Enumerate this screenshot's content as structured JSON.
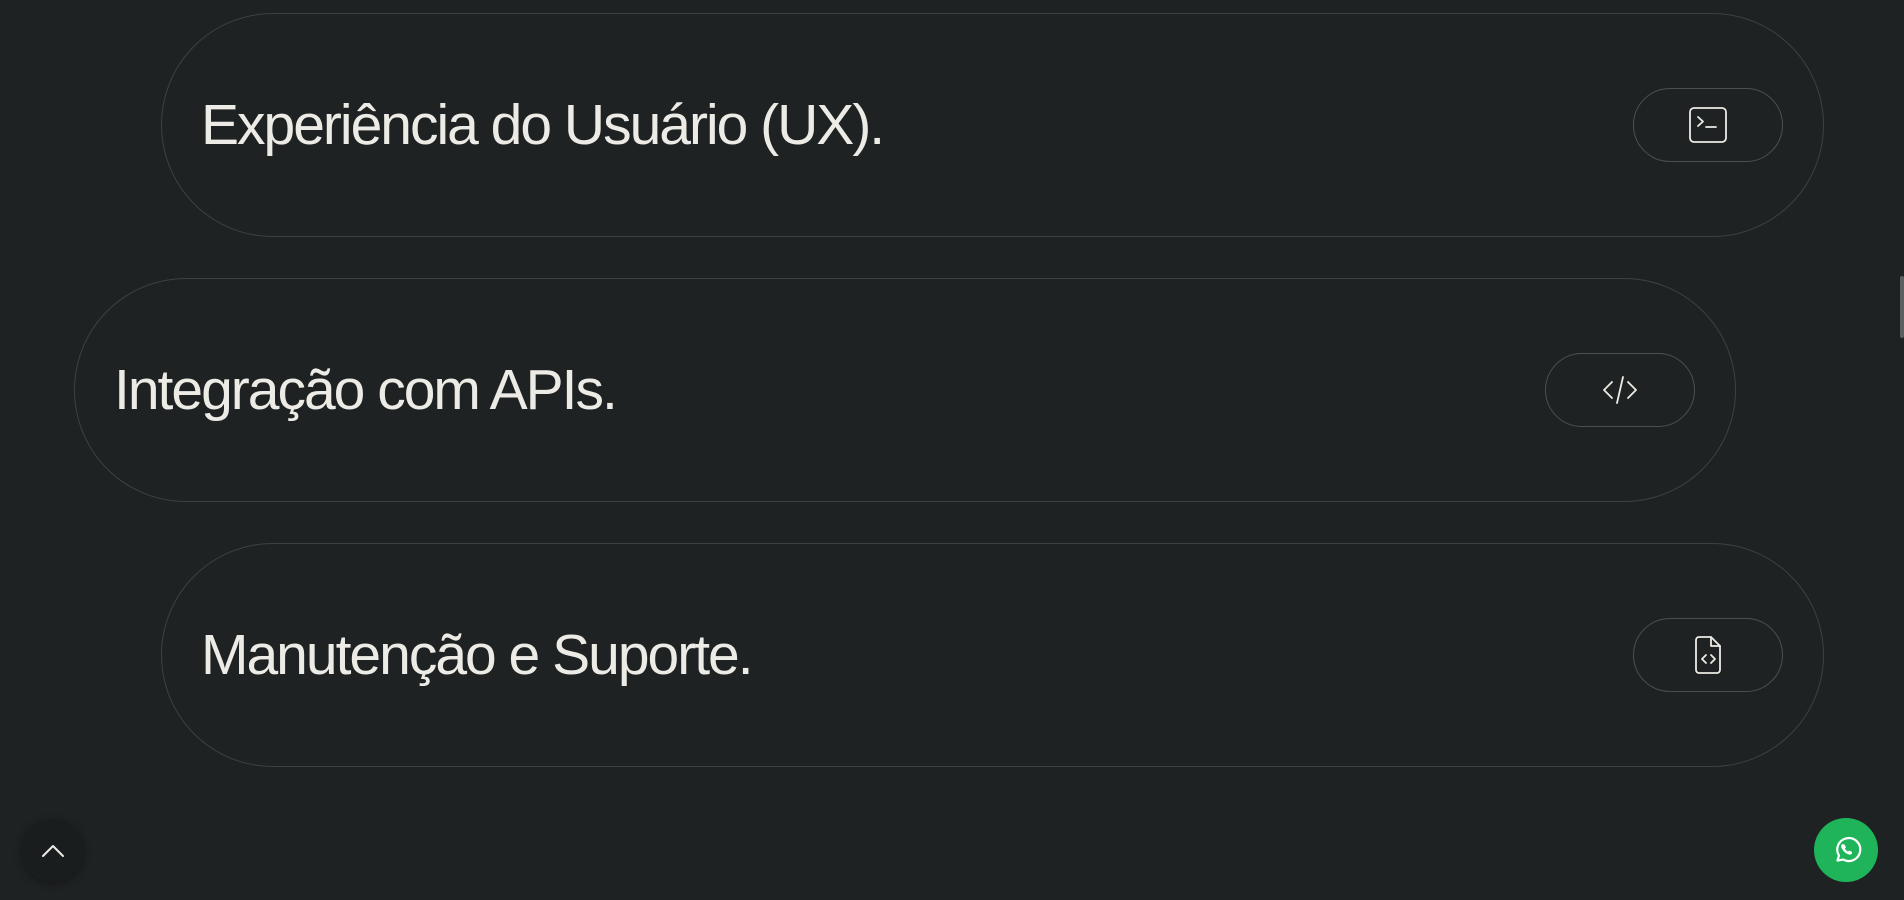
{
  "services": [
    {
      "title": "Experiência do Usuário (UX).",
      "icon": "terminal-icon"
    },
    {
      "title": "Integração com APIs.",
      "icon": "code-icon"
    },
    {
      "title": "Manutenção e Suporte.",
      "icon": "code-file-icon"
    }
  ],
  "floating": {
    "scroll_top_icon": "chevron-up-icon",
    "whatsapp_icon": "whatsapp-icon"
  },
  "colors": {
    "background": "#1f2223",
    "text": "#ecebe5",
    "border": "#3c4143",
    "whatsapp": "#1fb45a"
  }
}
